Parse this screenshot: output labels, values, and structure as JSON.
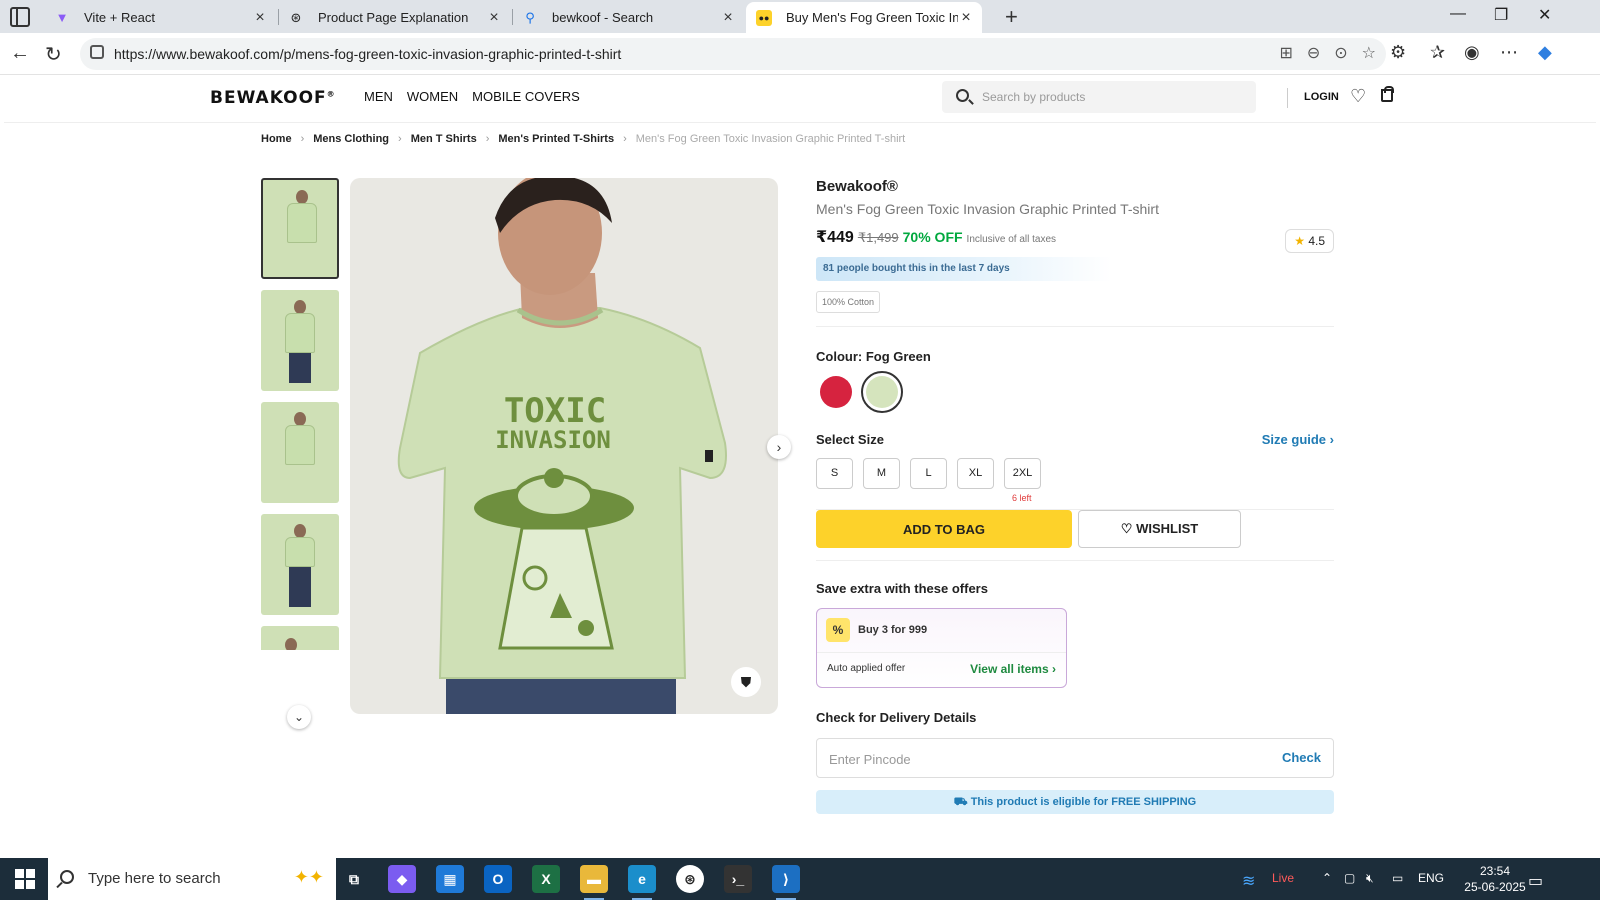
{
  "browser": {
    "tabs": [
      {
        "title": "Vite + React",
        "icon": "vite-icon"
      },
      {
        "title": "Product Page Explanation",
        "icon": "openai-icon"
      },
      {
        "title": "bewkoof - Search",
        "icon": "search-icon"
      },
      {
        "title": "Buy Men's Fog Green Toxic Invasi",
        "icon": "bewakoof-icon"
      }
    ],
    "url": "https://www.bewakoof.com/p/mens-fog-green-toxic-invasion-graphic-printed-t-shirt"
  },
  "header": {
    "logo": "BEWAKOOF",
    "logo_mark": "®",
    "nav": [
      "MEN",
      "WOMEN",
      "MOBILE COVERS"
    ],
    "search_placeholder": "Search by products",
    "login": "LOGIN"
  },
  "breadcrumb": [
    "Home",
    "Mens Clothing",
    "Men T Shirts",
    "Men's Printed T-Shirts",
    "Men's Fog Green Toxic Invasion Graphic Printed T-shirt"
  ],
  "product": {
    "print_line1": "TOXIC",
    "print_line2": "INVASION",
    "brand": "Bewakoof®",
    "name": "Men's Fog Green Toxic Invasion Graphic Printed T-shirt",
    "price": "₹449",
    "mrp": "₹1,499",
    "discount": "70% OFF",
    "tax_note": "Inclusive of all taxes",
    "rating": "4.5",
    "bought_note": "81 people bought this in the last 7 days",
    "fabric": "100% Cotton",
    "colour_label": "Colour: Fog Green",
    "colours": [
      {
        "name": "red",
        "hex": "#d6233f"
      },
      {
        "name": "fog-green",
        "hex": "#d5e4bd"
      }
    ],
    "size_title": "Select Size",
    "size_guide": "Size guide",
    "sizes": [
      "S",
      "M",
      "L",
      "XL",
      "2XL"
    ],
    "size_note": "6 left",
    "add_to_bag": "ADD TO BAG",
    "wishlist": "WISHLIST",
    "offers_title": "Save extra with these offers",
    "offer_name": "Buy 3 for 999",
    "offer_auto": "Auto applied offer",
    "offer_view": "View all items",
    "delivery_title": "Check for Delivery Details",
    "pincode_placeholder": "Enter Pincode",
    "pincode_check": "Check",
    "free_shipping": "This product is eligible for FREE SHIPPING"
  },
  "taskbar": {
    "search_text": "Type here to search",
    "live": "Live",
    "lang": "ENG",
    "time": "23:54",
    "date": "25-06-2025"
  },
  "colors": {
    "accent_yellow": "#fdd22a",
    "discount_green": "#00a83e",
    "link_blue": "#207bb4",
    "shirt_green": "#cfe0b6",
    "print_green": "#6e8f3e"
  }
}
